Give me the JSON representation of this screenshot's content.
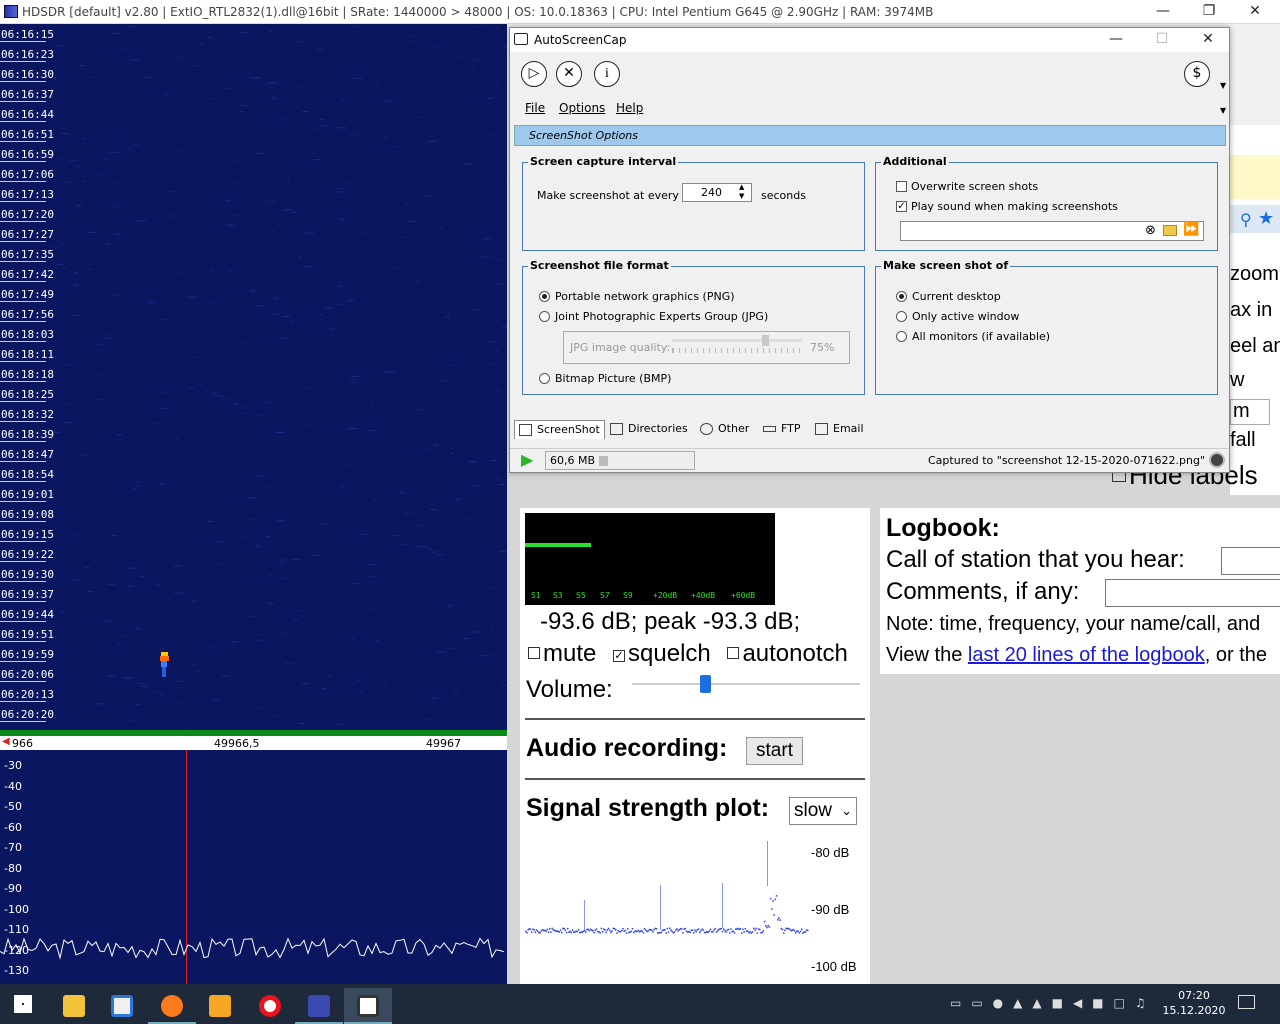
{
  "hdsdr": {
    "title": "HDSDR  [default]  v2.80   |  ExtIO_RTL2832(1).dll@16bit  |  SRate: 1440000 > 48000  |  OS: 10.0.18363  |  CPU: Intel Pentium G645 @ 2.90GHz  |  RAM: 3974MB",
    "times": [
      "06:16:15",
      "06:16:23",
      "06:16:30",
      "06:16:37",
      "06:16:44",
      "06:16:51",
      "06:16:59",
      "06:17:06",
      "06:17:13",
      "06:17:20",
      "06:17:27",
      "06:17:35",
      "06:17:42",
      "06:17:49",
      "06:17:56",
      "06:18:03",
      "06:18:11",
      "06:18:18",
      "06:18:25",
      "06:18:32",
      "06:18:39",
      "06:18:47",
      "06:18:54",
      "06:19:01",
      "06:19:08",
      "06:19:15",
      "06:19:22",
      "06:19:30",
      "06:19:37",
      "06:19:44",
      "06:19:51",
      "06:19:59",
      "06:20:06",
      "06:20:13",
      "06:20:20"
    ],
    "freq_labels": [
      "966",
      "49966,5",
      "49967"
    ],
    "db_labels": [
      "-30",
      "-40",
      "-50",
      "-60",
      "-70",
      "-80",
      "-90",
      "-100",
      "-110",
      "-120",
      "-130"
    ]
  },
  "asc": {
    "title": "AutoScreenCap",
    "menu": [
      "File",
      "Options",
      "Help"
    ],
    "section": "ScreenShot Options",
    "interval": {
      "legend": "Screen capture interval",
      "label": "Make screenshot at every",
      "value": "240",
      "unit": "seconds"
    },
    "additional": {
      "legend": "Additional",
      "overwrite": "Overwrite screen shots",
      "play_sound": "Play sound when making screenshots",
      "overwrite_checked": false,
      "sound_checked": true
    },
    "format": {
      "legend": "Screenshot file format",
      "png": "Portable network graphics (PNG)",
      "jpg": "Joint Photographic Experts Group (JPG)",
      "quality_label": "JPG image quality:",
      "quality_value": "75%",
      "bmp": "Bitmap Picture (BMP)"
    },
    "target": {
      "legend": "Make screen shot of",
      "desktop": "Current desktop",
      "active": "Only active window",
      "all": "All monitors (if available)"
    },
    "tabs": [
      "ScreenShot",
      "Directories",
      "Other",
      "FTP",
      "Email"
    ],
    "status_size": "60,6 MB",
    "status_msg": "Captured to \"screenshot 12-15-2020-071622.png\""
  },
  "web": {
    "meter_labels": [
      "S1",
      "S3",
      "S5",
      "S7",
      "S9",
      "+20dB",
      "+40dB",
      "+60dB"
    ],
    "level_line": "-93.6 dB; peak    -93.3 dB;",
    "mute": "mute",
    "squelch": "squelch",
    "autonotch": "autonotch",
    "volume": "Volume:",
    "volume_level": 0.32,
    "audio_recording": "Audio recording:",
    "start": "start",
    "signal_plot": "Signal strength plot:",
    "plot_speed": "slow",
    "plot_db": [
      "-80 dB",
      "-90 dB",
      "-100 dB"
    ],
    "logbook": "Logbook:",
    "call_label": "Call of station that you hear:",
    "comments_label": "Comments, if any:",
    "note": "Note: time, frequency, your name/call, and",
    "view_prefix": "View the ",
    "view_link": "last 20 lines of the logbook",
    "view_suffix": ", or the",
    "strip": [
      "zoom i",
      "ax in",
      "eel an",
      "w",
      "m",
      "fall"
    ],
    "hide_labels": "Hide labels"
  },
  "taskbar": {
    "time": "07:20",
    "date": "15.12.2020"
  }
}
